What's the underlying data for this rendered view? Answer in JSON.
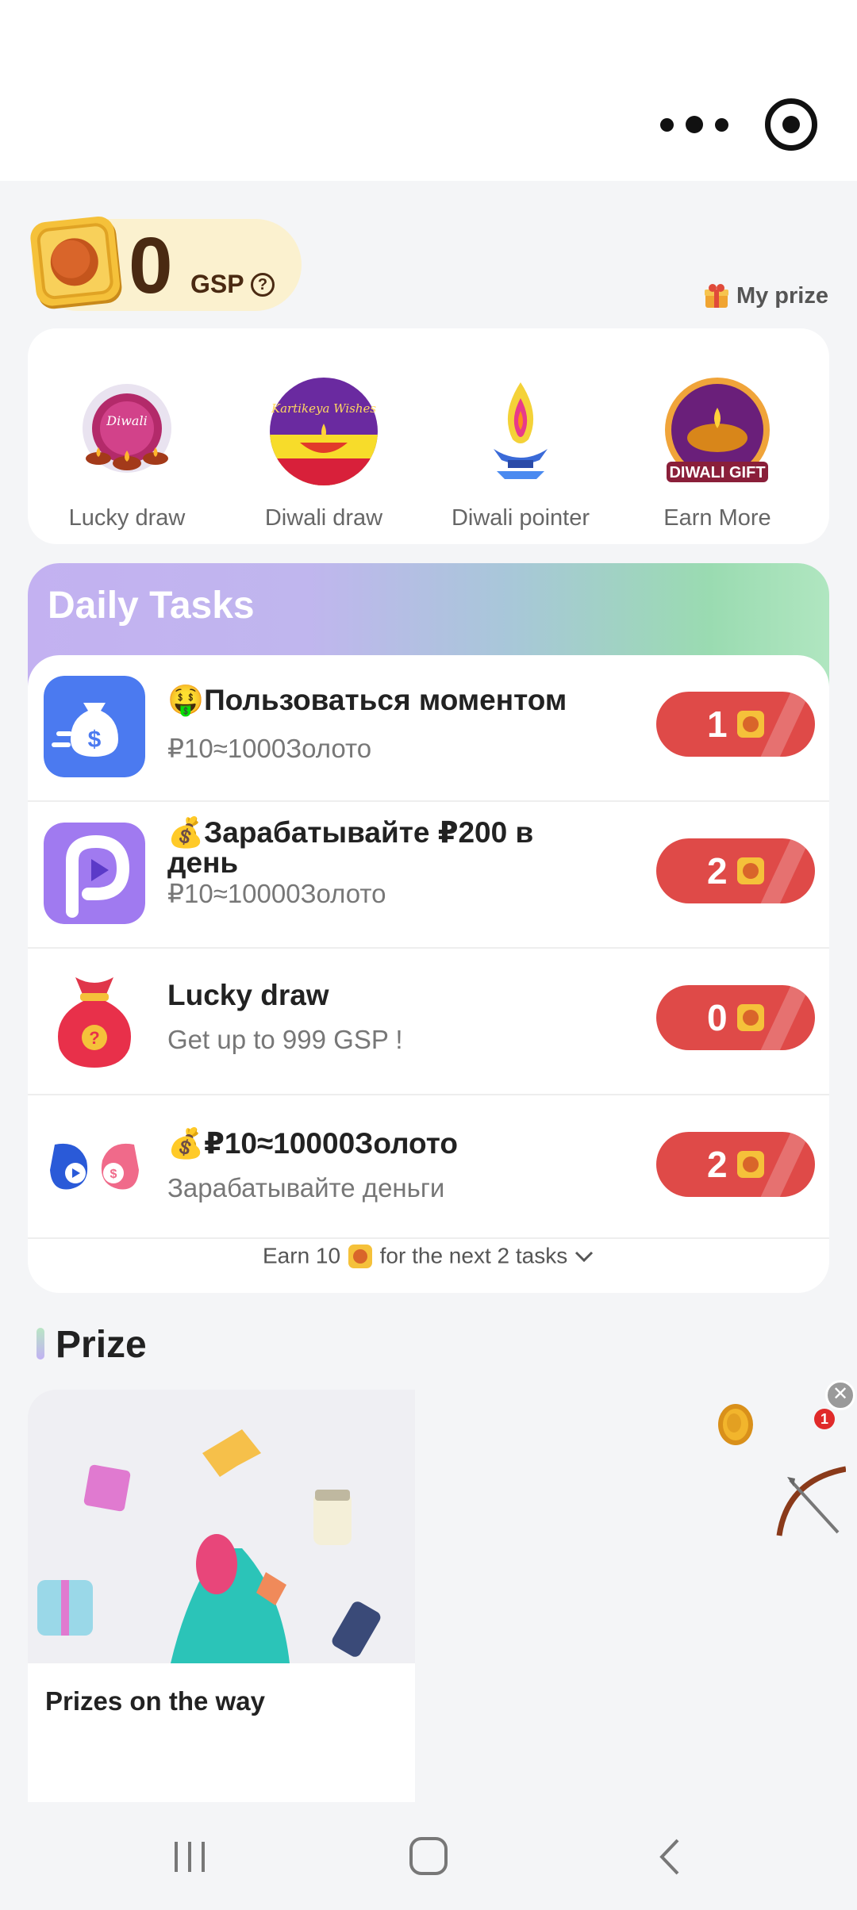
{
  "header": {
    "more_icon": "more-dots-icon",
    "target_icon": "target-icon"
  },
  "balance": {
    "value": "0",
    "unit": "GSP",
    "help_icon": "question-circle-icon",
    "my_prize_label": "My prize"
  },
  "games": [
    {
      "label": "Lucky draw",
      "icon": "diwali-lamps-icon"
    },
    {
      "label": "Diwali draw",
      "icon": "kartikeya-wishes-icon"
    },
    {
      "label": "Diwali pointer",
      "icon": "oil-lamp-icon"
    },
    {
      "label": "Earn More",
      "icon": "diwali-gift-icon",
      "badge_text": "DIWALI GIFT"
    }
  ],
  "daily_tasks": {
    "title": "Daily Tasks",
    "tasks": [
      {
        "title": "🤑Пользоваться моментом",
        "subtitle": "₽10≈1000Золото",
        "reward": "1",
        "icon": "money-bag-app-icon"
      },
      {
        "title": "💰Зарабатывайте ₽200 в день",
        "subtitle": "₽10≈10000Золото",
        "reward": "2",
        "icon": "play-p-app-icon"
      },
      {
        "title": "Lucky draw",
        "subtitle": "Get up to 999 GSP !",
        "reward": "0",
        "icon": "lucky-bag-icon"
      },
      {
        "title": "💰₽10≈10000Золото",
        "subtitle": "Зарабатывайте деньги",
        "reward": "2",
        "icon": "owl-app-icon"
      }
    ],
    "footer_prefix": "Earn 10",
    "footer_suffix": "for the next 2 tasks",
    "footer_chevron": "chevron-down-icon"
  },
  "prize": {
    "title": "Prize",
    "card_label": "Prizes on the way"
  },
  "floating_widget": {
    "badge_count": "1",
    "close_icon": "close-icon"
  },
  "colors": {
    "reward_red": "#df4a48",
    "balance_bg": "#fbf1cf",
    "coin_gold": "#f2b52c"
  }
}
